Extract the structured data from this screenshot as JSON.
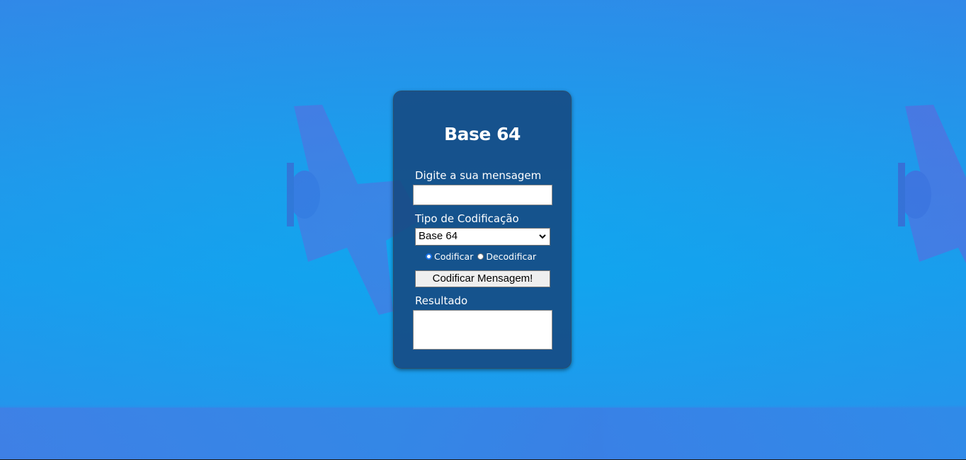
{
  "card": {
    "title": "Base 64",
    "message_label": "Digite a sua mensagem",
    "message_value": "",
    "encoding_label": "Tipo de Codificação",
    "encoding_selected": "Base 64",
    "radio_encode_label": "Codificar",
    "radio_decode_label": "Decodificar",
    "radio_selected": "Codificar",
    "submit_label": "Codificar Mensagem!",
    "result_label": "Resultado",
    "result_value": ""
  },
  "colors": {
    "background": "#1aa0ec",
    "card": "#1a4e80",
    "accent_radio": "#1a73e8"
  }
}
